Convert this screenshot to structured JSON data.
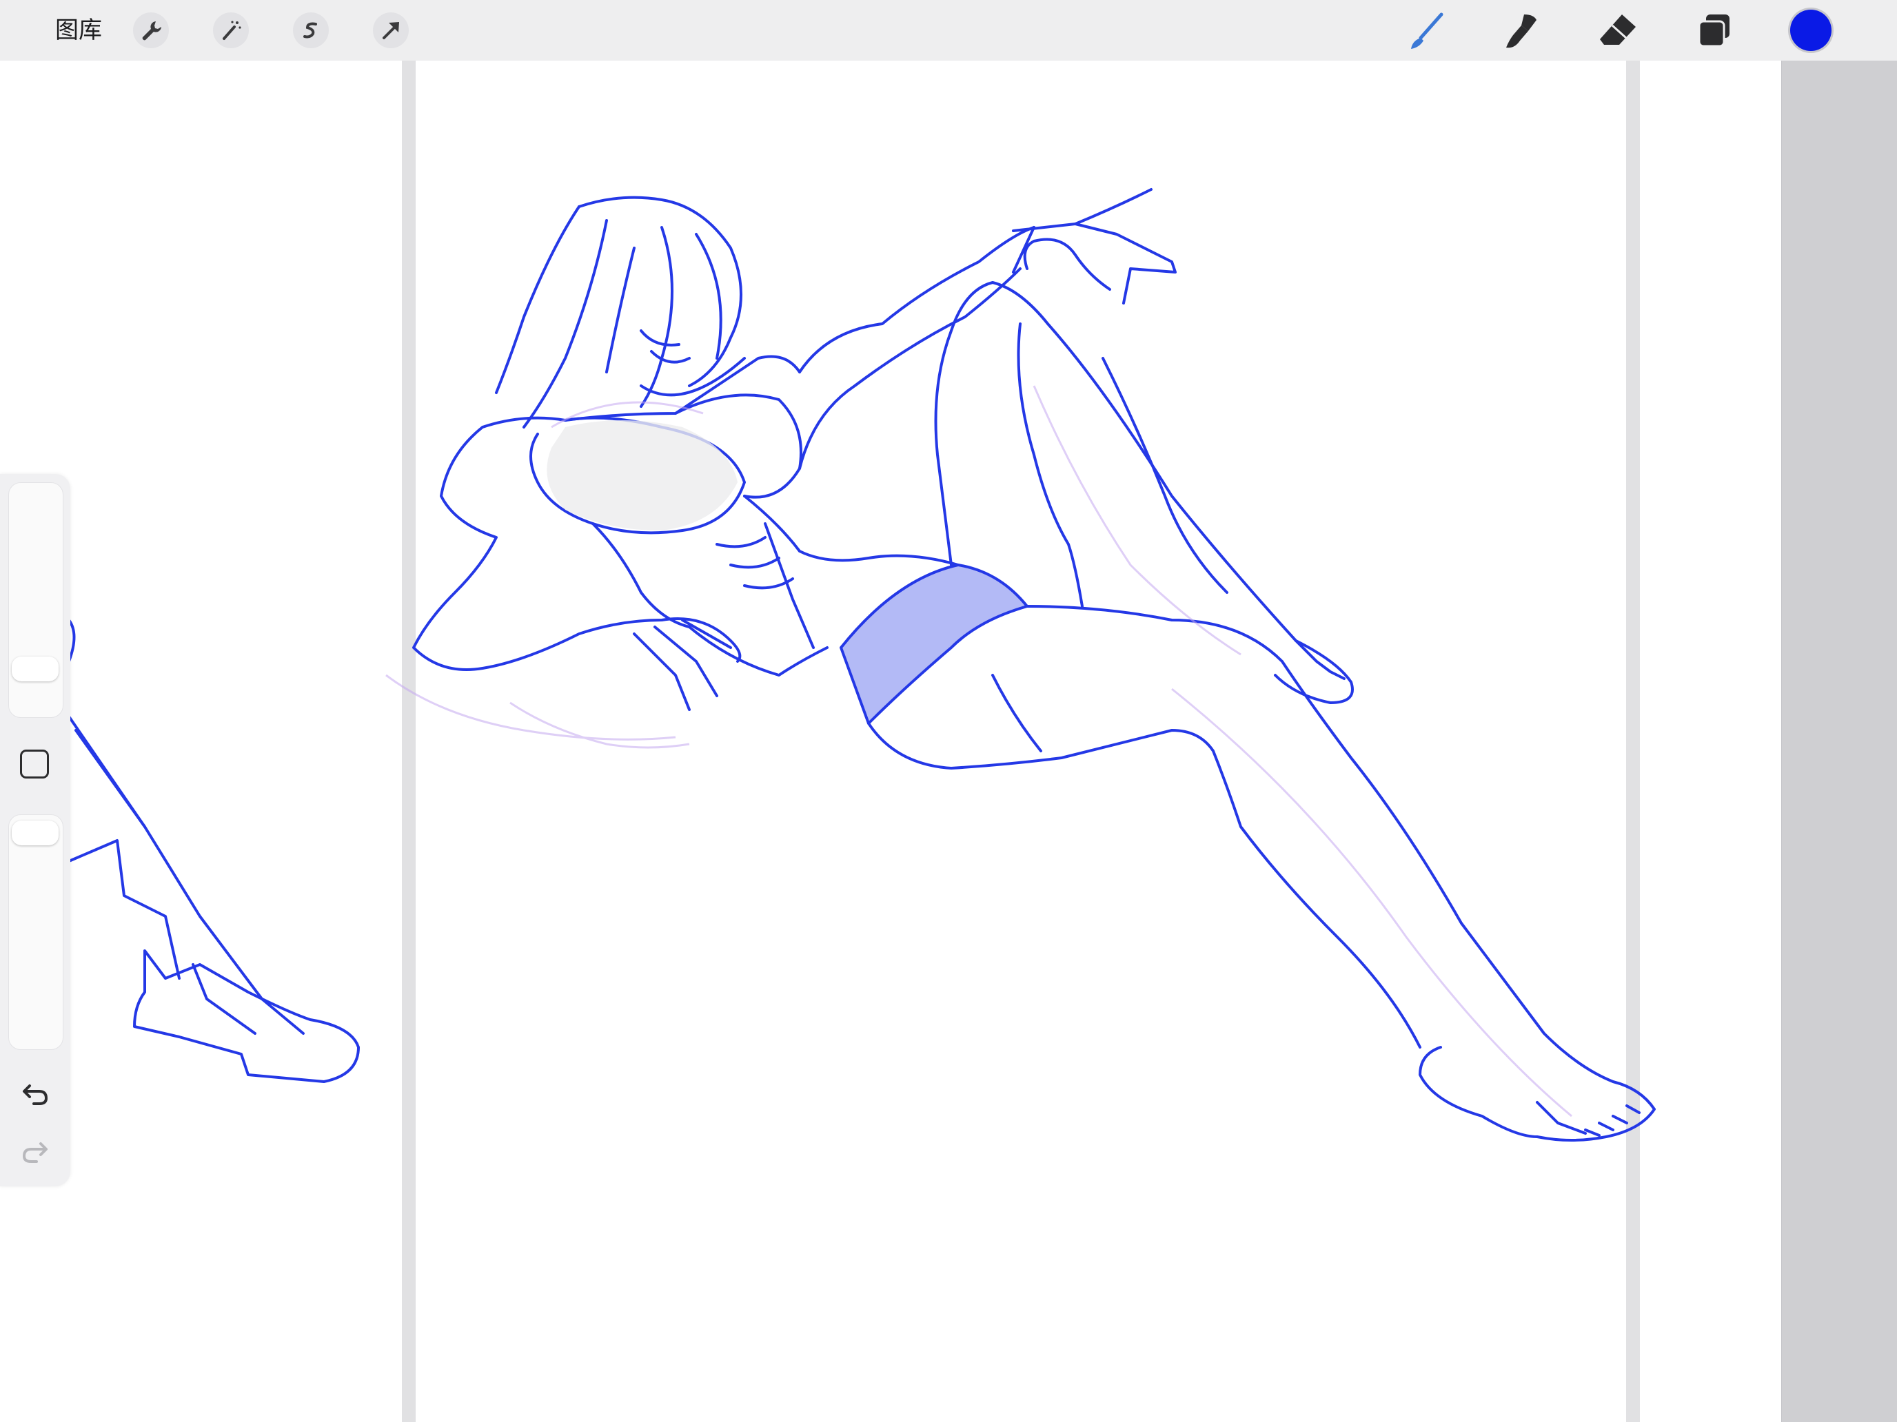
{
  "toolbar": {
    "gallery_label": "图库",
    "left_tools": [
      "wrench-icon",
      "magic-wand-icon",
      "selection-icon",
      "transform-arrow-icon"
    ],
    "right_tools": [
      "brush-icon",
      "smudge-icon",
      "eraser-icon",
      "layers-icon"
    ],
    "current_color": "#0a1ae6"
  },
  "sidebar": {
    "brush_size_level": 0.72,
    "opacity_level": 0.97
  },
  "colors": {
    "toolbar_bg": "#eeeeef",
    "sketch_line": "#2438e6",
    "accent_blue": "#3a78d6"
  }
}
